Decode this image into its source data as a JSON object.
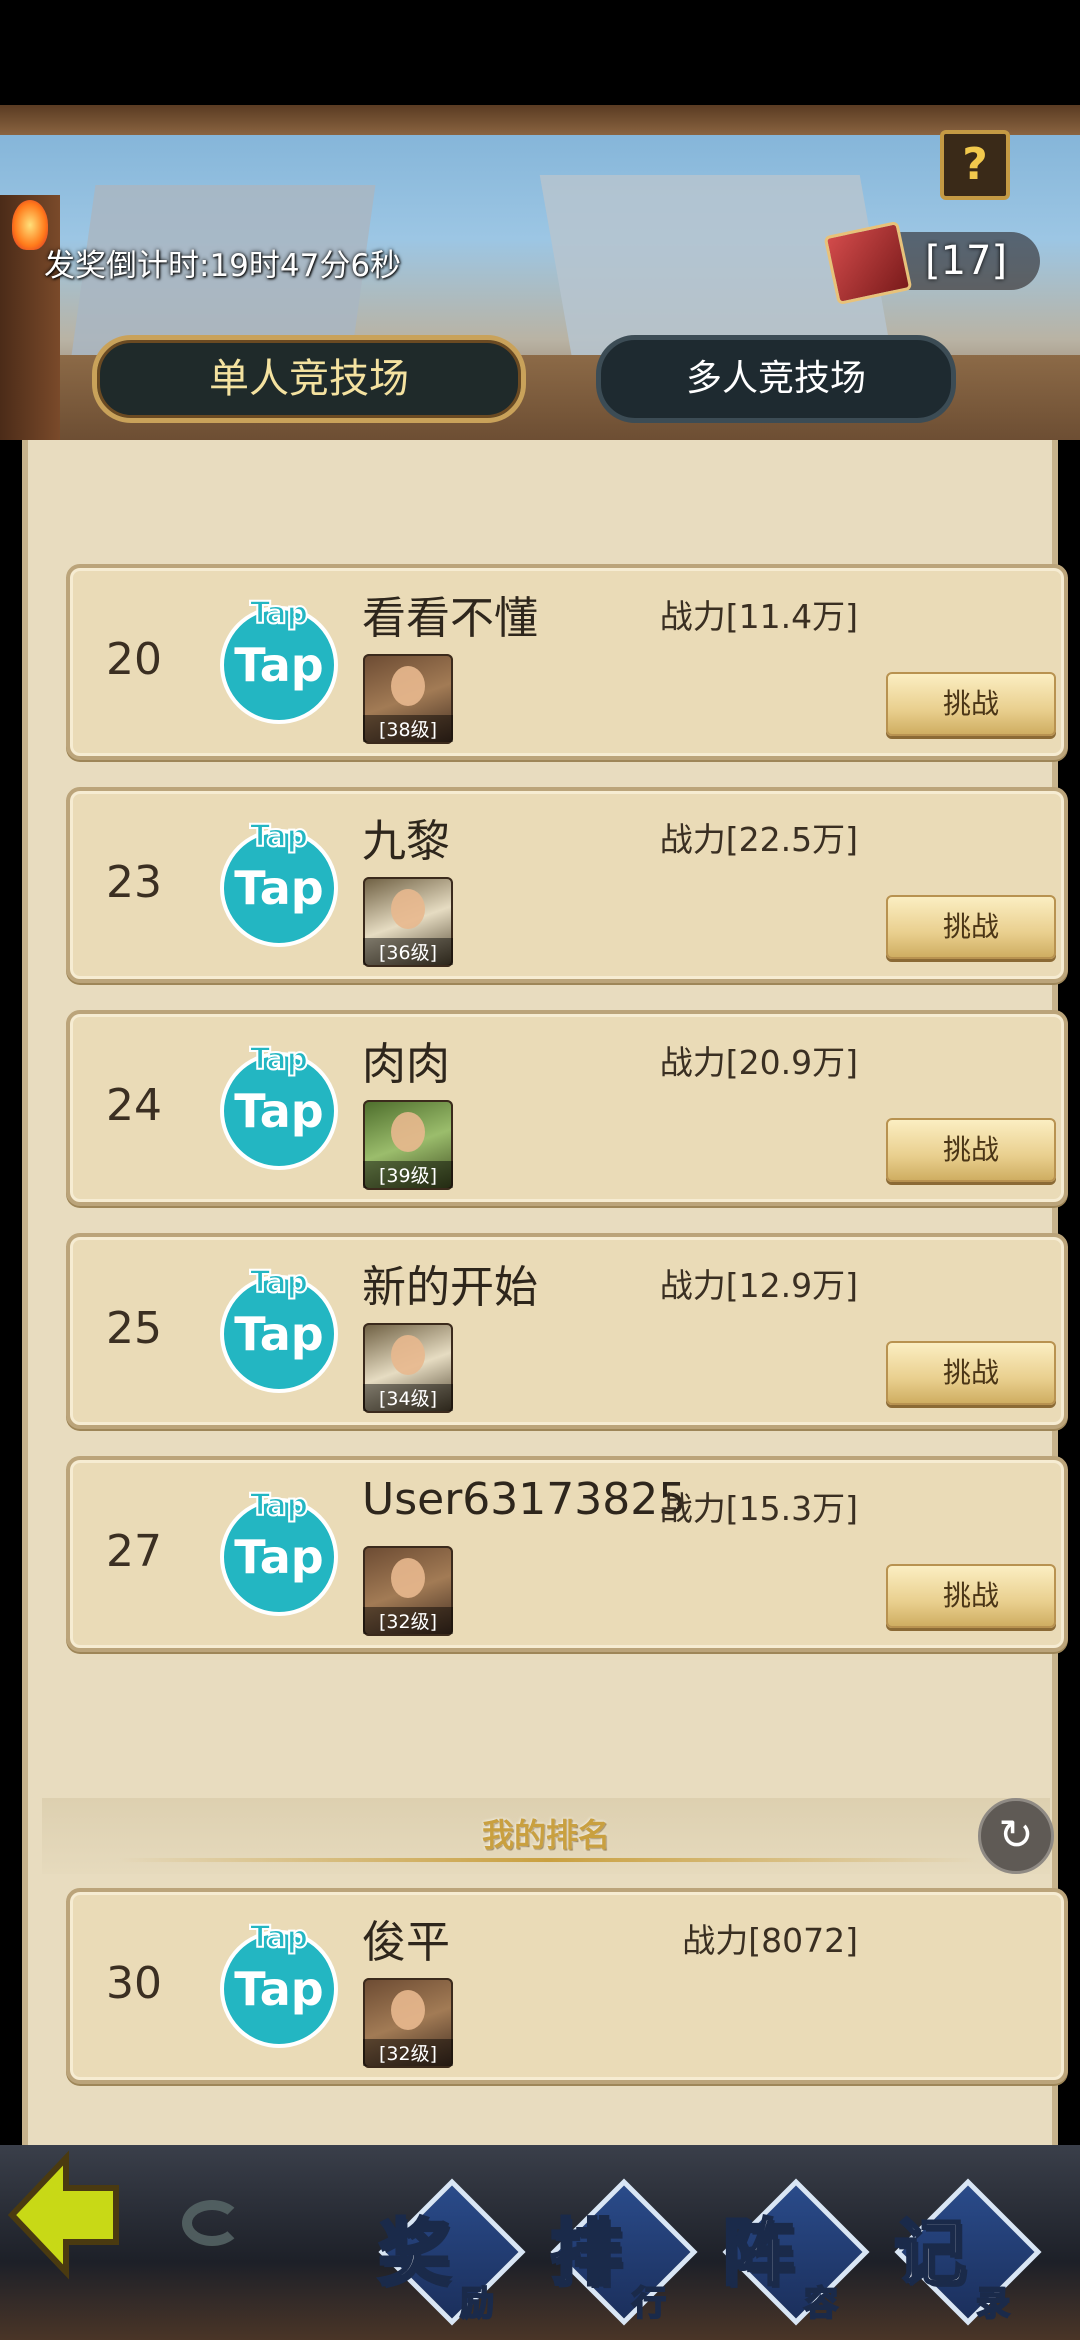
{
  "header": {
    "countdown": "发奖倒计时:19时47分6秒",
    "ticket_count": "[17]",
    "help_label": "?"
  },
  "tabs": [
    {
      "label": "单人竞技场",
      "active": true
    },
    {
      "label": "多人竞技场",
      "active": false
    }
  ],
  "opponents": [
    {
      "rank": "20",
      "name": "看看不懂",
      "power": "战力[11.4万]",
      "hero_level": "[38级]",
      "button": "挑战"
    },
    {
      "rank": "23",
      "name": "九黎",
      "power": "战力[22.5万]",
      "hero_level": "[36级]",
      "button": "挑战"
    },
    {
      "rank": "24",
      "name": "肉肉",
      "power": "战力[20.9万]",
      "hero_level": "[39级]",
      "button": "挑战"
    },
    {
      "rank": "25",
      "name": "新的开始",
      "power": "战力[12.9万]",
      "hero_level": "[34级]",
      "button": "挑战"
    },
    {
      "rank": "27",
      "name": "User63173825",
      "power": "战力[15.3万]",
      "hero_level": "[32级]",
      "button": "挑战"
    }
  ],
  "logo": {
    "top": "Tap",
    "main": "Tap"
  },
  "my_rank": {
    "title": "我的排名",
    "rank": "30",
    "name": "俊平",
    "power": "战力[8072]",
    "hero_level": "[32级]"
  },
  "bottom_nav": [
    {
      "big": "奖",
      "small": "励"
    },
    {
      "big": "排",
      "small": "行"
    },
    {
      "big": "阵",
      "small": "容"
    },
    {
      "big": "记",
      "small": "录"
    }
  ],
  "colors": {
    "accent_gold": "#c9a25a",
    "logo_teal": "#23b6c2",
    "card_bg": "#eadbb7"
  }
}
